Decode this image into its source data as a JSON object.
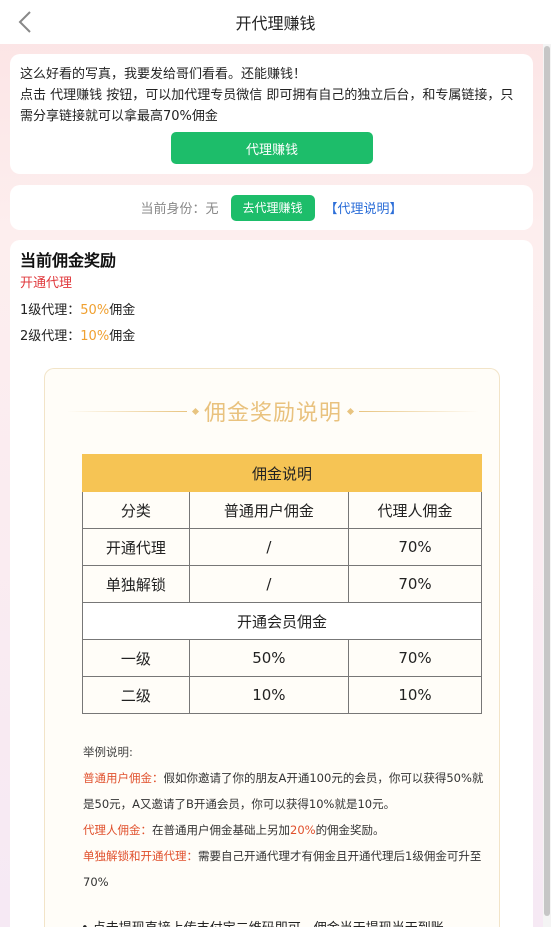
{
  "nav": {
    "title": "开代理赚钱"
  },
  "intro": {
    "line1": "这么好看的写真，我要发给哥们看看。还能赚钱！",
    "line2": "点击 代理赚钱 按钮，可以加代理专员微信 即可拥有自己的独立后台，和专属链接，只需分享链接就可以拿最高70%佣金",
    "button": "代理赚钱"
  },
  "identity": {
    "label": "当前身份：无",
    "button": "去代理赚钱",
    "link": "【代理说明】"
  },
  "commission": {
    "title": "当前佣金奖励",
    "type": "开通代理",
    "level1_prefix": "1级代理：",
    "level1_value": "50%",
    "level1_suffix": "佣金",
    "level2_prefix": "2级代理：",
    "level2_value": "10%",
    "level2_suffix": "佣金"
  },
  "panel": {
    "title": "佣金奖励说明",
    "table": {
      "header": "佣金说明",
      "columns": [
        "分类",
        "普通用户佣金",
        "代理人佣金"
      ],
      "rows": [
        [
          "开通代理",
          "/",
          "70%"
        ],
        [
          "单独解锁",
          "/",
          "70%"
        ]
      ],
      "subheader": "开通会员佣金",
      "member_rows": [
        [
          "一级",
          "50%",
          "70%"
        ],
        [
          "二级",
          "10%",
          "10%"
        ]
      ]
    },
    "example": {
      "title": "举例说明:",
      "p1_label": "普通用户佣金：",
      "p1_text": "假如你邀请了你的朋友A开通100元的会员，你可以获得50%就是50元，A又邀请了B开通会员，你可以获得10%就是10元。",
      "p2_label": "代理人佣金：",
      "p2_text_a": "在普通用户佣金基础上另加",
      "p2_highlight": "20%",
      "p2_text_b": "的佣金奖励。",
      "p3_label": "单独解锁和开通代理：",
      "p3_text": "需要自己开通代理才有佣金且开通代理后1级佣金可升至70%"
    },
    "bullet": "• 点击提现直接上传支付宝二维码即可，佣金当天提现当天到账"
  },
  "colors": {
    "green": "#1dbd6a",
    "red": "#e0383c",
    "orange": "#f0a030",
    "gold": "#f6c454",
    "link": "#2c6ed8"
  }
}
